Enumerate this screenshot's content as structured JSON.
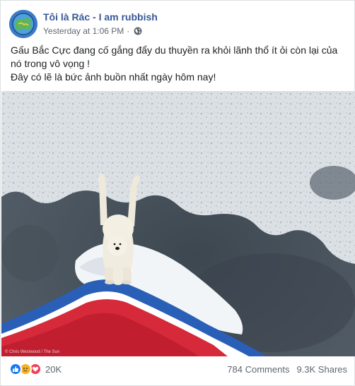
{
  "post": {
    "author": "Tôi là Rác - I am rubbish",
    "timestamp": "Yesterday at 1:06 PM",
    "separator": "·",
    "privacy_icon": "globe-icon",
    "caption_lines": [
      "Gấu Bắc Cực đang cố gắng đẩy du thuyền ra khỏi lãnh thổ ít ỏi còn lại của nó trong vô vọng !",
      "Đây có lẽ là bức ảnh buồn nhất ngày hôm nay!"
    ],
    "photo_credit": "© Chris Westwood / The Sun"
  },
  "footer": {
    "reaction_icons": [
      "like-icon",
      "sad-icon",
      "love-icon"
    ],
    "reaction_count": "20K",
    "comments": "784 Comments",
    "shares": "9.3K Shares"
  },
  "colors": {
    "author_link": "#385898",
    "meta_text": "#606770",
    "like": "#1877f2",
    "sad": "#f7b125",
    "love": "#f33e58"
  }
}
